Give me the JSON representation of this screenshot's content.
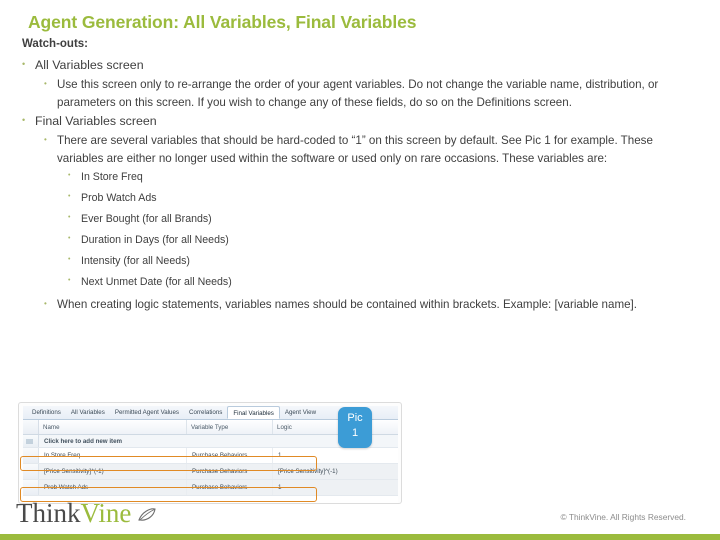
{
  "slide": {
    "title": "Agent Generation: All Variables, Final Variables",
    "subtitle": "Watch-outs:"
  },
  "outline": [
    {
      "level": 1,
      "text": "All Variables screen"
    },
    {
      "level": 2,
      "text": "Use this screen only to re-arrange the order of your agent variables.  Do not change the variable name, distribution, or parameters on this screen.  If you wish to change any of these fields, do so on the Definitions screen."
    },
    {
      "level": 1,
      "text": "Final Variables screen"
    },
    {
      "level": 2,
      "text": "There are several variables that should be hard-coded to “1” on this screen by default.  See Pic 1 for example.  These variables are either no longer used within the software or used only on rare occasions.  These variables are:"
    },
    {
      "level": 3,
      "text": "In Store Freq"
    },
    {
      "level": 3,
      "text": "Prob Watch Ads"
    },
    {
      "level": 3,
      "text": "Ever Bought (for all Brands)"
    },
    {
      "level": 3,
      "text": "Duration in Days (for all Needs)"
    },
    {
      "level": 3,
      "text": "Intensity (for all Needs)"
    },
    {
      "level": 3,
      "text": "Next Unmet Date  (for all Needs)"
    },
    {
      "level": 2,
      "text": "When creating logic statements, variables names should be contained within brackets.  Example: [variable name]."
    }
  ],
  "bullet_glyph": "•",
  "screenshot": {
    "tabs": [
      {
        "label": "Definitions",
        "active": false
      },
      {
        "label": "All Variables",
        "active": false
      },
      {
        "label": "Permitted Agent Values",
        "active": false
      },
      {
        "label": "Correlations",
        "active": false
      },
      {
        "label": "Final Variables",
        "active": true
      },
      {
        "label": "Agent View",
        "active": false
      }
    ],
    "columns": [
      "Name",
      "Variable Type",
      "Logic"
    ],
    "add_new_row_label": "Click here to add new item",
    "rows": [
      {
        "name": "In Store Freq",
        "type": "Purchase Behaviors",
        "logic": "1",
        "highlighted": true
      },
      {
        "name": "[Price Sensitivity]^(-1)",
        "type": "Purchase Behaviors",
        "logic": "[Price Sensitivity]^(-1)",
        "highlighted": false
      },
      {
        "name": "Prob Watch Ads",
        "type": "Purchase Behaviors",
        "logic": "1",
        "highlighted": true
      }
    ],
    "badge": {
      "line1": "Pic",
      "line2": "1"
    }
  },
  "footer": {
    "logo_first": "Think",
    "logo_second": "Vine",
    "logo_mark": "❦",
    "copyright": "© ThinkVine.  All Rights Reserved."
  },
  "colors": {
    "accent_green": "#9BBB3D",
    "badge_blue": "#3C9CD6",
    "highlight_orange": "#E08A25",
    "body_text": "#3F3F3F"
  }
}
